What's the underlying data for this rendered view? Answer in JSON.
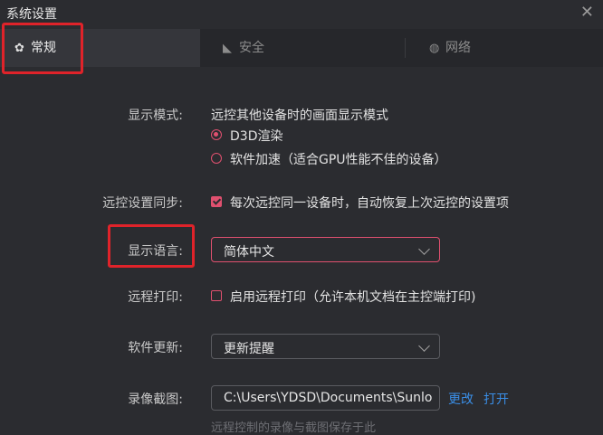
{
  "window": {
    "title": "系统设置",
    "close_glyph": "✕"
  },
  "tabs": [
    {
      "label": "常规",
      "icon": "gear-icon",
      "glyph": "✿"
    },
    {
      "label": "安全",
      "icon": "shield-icon",
      "glyph": "◣"
    },
    {
      "label": "网络",
      "icon": "globe-icon",
      "glyph": "◍"
    }
  ],
  "settings": {
    "display_mode": {
      "label": "显示模式:",
      "description": "远控其他设备时的画面显示模式",
      "options": [
        "D3D渲染",
        "软件加速（适合GPU性能不佳的设备）"
      ],
      "selected": "D3D渲染"
    },
    "sync": {
      "label": "远控设置同步:",
      "checkbox_label": "每次远控同一设备时，自动恢复上次远控的设置项",
      "checked": true
    },
    "language": {
      "label": "显示语言:",
      "value": "简体中文"
    },
    "remote_print": {
      "label": "远程打印:",
      "checkbox_label": "启用远程打印（允许本机文档在主控端打印)",
      "checked": false
    },
    "update": {
      "label": "软件更新:",
      "value": "更新提醒"
    },
    "recording": {
      "label": "录像截图:",
      "path": "C:\\Users\\YDSD\\Documents\\Sunlo",
      "change_label": "更改",
      "open_label": "打开",
      "hint": "远程控制的录像与截图保存于此"
    }
  },
  "colors": {
    "accent": "#e0506f",
    "link": "#3a8ee6",
    "highlight": "#e0232a",
    "background": "#2b2c30"
  }
}
